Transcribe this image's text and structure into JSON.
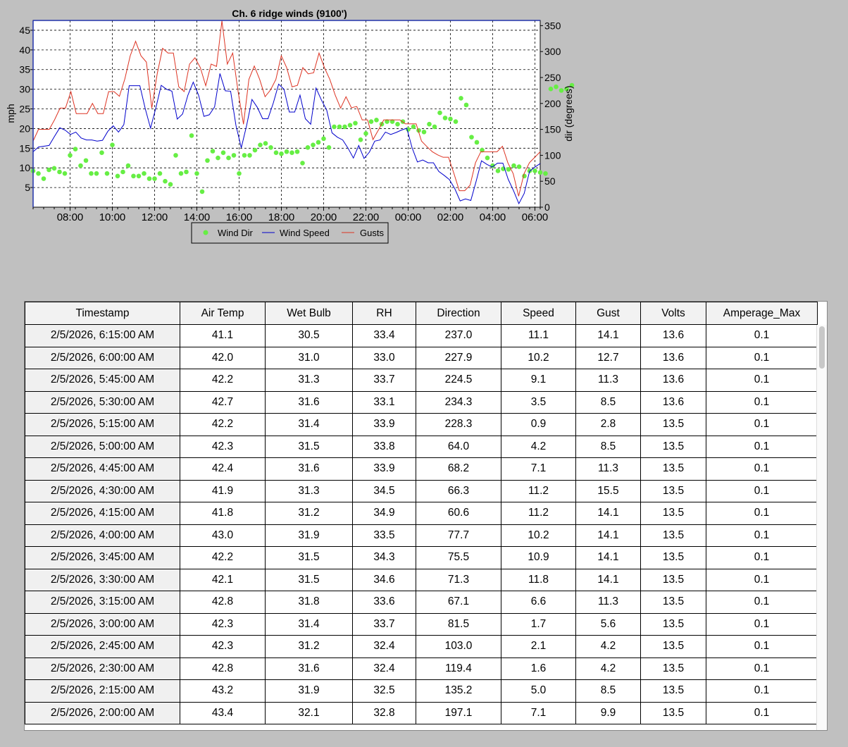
{
  "chart_data": {
    "type": "line",
    "title": "Ch. 6 ridge winds (9100')",
    "ylabel_left": "mph",
    "ylabel_right": "dir (degrees)",
    "ylim_left": [
      0,
      47.5
    ],
    "ylim_right": [
      0,
      360
    ],
    "yticks_left": [
      5,
      10,
      15,
      20,
      25,
      30,
      35,
      40,
      45
    ],
    "yticks_right": [
      0,
      50,
      100,
      150,
      200,
      250,
      300,
      350
    ],
    "xticks": [
      "08:00",
      "10:00",
      "12:00",
      "14:00",
      "16:00",
      "18:00",
      "20:00",
      "22:00",
      "00:00",
      "02:00",
      "04:00",
      "06:00"
    ],
    "x_start": "06:15",
    "x_end": "06:15",
    "interval_minutes": 15,
    "grid": true,
    "legend_position": "bottom",
    "series": [
      {
        "name": "Wind Dir",
        "color": "#66ee44",
        "style": "points",
        "values": [
          70,
          65,
          55,
          72,
          75,
          68,
          65,
          100,
          112,
          80,
          90,
          65,
          65,
          105,
          65,
          120,
          60,
          68,
          80,
          60,
          60,
          65,
          55,
          55,
          65,
          50,
          44,
          100,
          65,
          68,
          138,
          65,
          30,
          90,
          108,
          95,
          105,
          95,
          100,
          65,
          100,
          100,
          110,
          120,
          123,
          115,
          105,
          103,
          107,
          105,
          107,
          85,
          115,
          120,
          125,
          132,
          115,
          155,
          155,
          155,
          158,
          162,
          130,
          142,
          165,
          168,
          160,
          165,
          165,
          160,
          165,
          150,
          155,
          148,
          145,
          160,
          155,
          182,
          172,
          170,
          165,
          210,
          197,
          135,
          125,
          110,
          95,
          80,
          70,
          74,
          73,
          80,
          78,
          60,
          70,
          70,
          67,
          65,
          228,
          232,
          225,
          228,
          235
        ]
      },
      {
        "name": "Wind Speed",
        "color": "#0000cc",
        "style": "line",
        "values": [
          14.1,
          15.3,
          15.5,
          15.7,
          18,
          20.2,
          19.6,
          18.5,
          19.1,
          17.6,
          17.1,
          17.1,
          16.8,
          17,
          19.3,
          20.7,
          19.1,
          21,
          30.9,
          30.9,
          30.9,
          25.1,
          20.1,
          25.3,
          31,
          30,
          29.5,
          22.4,
          23.7,
          28.5,
          31.8,
          28.5,
          23.1,
          23.5,
          25.5,
          34,
          29.6,
          29.5,
          20.8,
          15.1,
          20.8,
          27.4,
          25.4,
          22.5,
          22.5,
          26.5,
          31.3,
          30,
          24.2,
          24.2,
          28.5,
          22.5,
          21.1,
          30.3,
          27.3,
          24.7,
          18.9,
          17.8,
          17.1,
          15,
          12.5,
          15.7,
          12.4,
          14,
          16.8,
          17.1,
          19.1,
          18.5,
          19,
          19.6,
          20.1,
          15.1,
          11.5,
          12,
          11.3,
          11.3,
          9.1,
          8.1,
          7,
          4.7,
          1.6,
          2.1,
          1.7,
          6.6,
          11.8,
          10.9,
          10.2,
          11.2,
          11.2,
          7.1,
          4.2,
          0.9,
          3.5,
          9.1,
          10.2,
          11.1
        ]
      },
      {
        "name": "Gusts",
        "color": "#dd3322",
        "style": "line",
        "values": [
          16.8,
          19.8,
          19.8,
          19.8,
          22.3,
          25.2,
          25.2,
          29.4,
          23.8,
          23.8,
          23.8,
          26.4,
          23.8,
          23.8,
          29.4,
          29.4,
          28.2,
          32.6,
          38.5,
          42.2,
          38.5,
          36.9,
          25.2,
          33.9,
          40.4,
          39.2,
          39.2,
          30.6,
          29.4,
          36.4,
          38,
          35.5,
          30.9,
          36.4,
          35.8,
          47.4,
          36.4,
          39.2,
          29.4,
          21.1,
          32.5,
          35.9,
          32.5,
          28.1,
          29.8,
          32.5,
          38.5,
          35.5,
          30.6,
          31,
          35.5,
          33.9,
          34.2,
          39.2,
          35.5,
          32.5,
          28.5,
          25.2,
          28.1,
          25.3,
          25.6,
          22.2,
          22.2,
          17.2,
          19.6,
          22.2,
          22.2,
          22.2,
          22.2,
          21.2,
          21.2,
          21.2,
          16.8,
          15.4,
          14.1,
          13.3,
          12.7,
          12.7,
          8.6,
          4.2,
          4.2,
          5.6,
          11.3,
          14.1,
          14.1,
          14.1,
          14.1,
          15.5,
          11.3,
          8.5,
          2.8,
          8.5,
          11.3,
          12.7,
          14.1
        ]
      }
    ]
  },
  "table": {
    "headers": [
      "Timestamp",
      "Air Temp",
      "Wet Bulb",
      "RH",
      "Direction",
      "Speed",
      "Gust",
      "Volts",
      "Amperage_Max"
    ],
    "rows": [
      [
        "2/5/2026, 6:15:00 AM",
        "41.1",
        "30.5",
        "33.4",
        "237.0",
        "11.1",
        "14.1",
        "13.6",
        "0.1"
      ],
      [
        "2/5/2026, 6:00:00 AM",
        "42.0",
        "31.0",
        "33.0",
        "227.9",
        "10.2",
        "12.7",
        "13.6",
        "0.1"
      ],
      [
        "2/5/2026, 5:45:00 AM",
        "42.2",
        "31.3",
        "33.7",
        "224.5",
        "9.1",
        "11.3",
        "13.6",
        "0.1"
      ],
      [
        "2/5/2026, 5:30:00 AM",
        "42.7",
        "31.6",
        "33.1",
        "234.3",
        "3.5",
        "8.5",
        "13.6",
        "0.1"
      ],
      [
        "2/5/2026, 5:15:00 AM",
        "42.2",
        "31.4",
        "33.9",
        "228.3",
        "0.9",
        "2.8",
        "13.5",
        "0.1"
      ],
      [
        "2/5/2026, 5:00:00 AM",
        "42.3",
        "31.5",
        "33.8",
        "64.0",
        "4.2",
        "8.5",
        "13.5",
        "0.1"
      ],
      [
        "2/5/2026, 4:45:00 AM",
        "42.4",
        "31.6",
        "33.9",
        "68.2",
        "7.1",
        "11.3",
        "13.5",
        "0.1"
      ],
      [
        "2/5/2026, 4:30:00 AM",
        "41.9",
        "31.3",
        "34.5",
        "66.3",
        "11.2",
        "15.5",
        "13.5",
        "0.1"
      ],
      [
        "2/5/2026, 4:15:00 AM",
        "41.8",
        "31.2",
        "34.9",
        "60.6",
        "11.2",
        "14.1",
        "13.5",
        "0.1"
      ],
      [
        "2/5/2026, 4:00:00 AM",
        "43.0",
        "31.9",
        "33.5",
        "77.7",
        "10.2",
        "14.1",
        "13.5",
        "0.1"
      ],
      [
        "2/5/2026, 3:45:00 AM",
        "42.2",
        "31.5",
        "34.3",
        "75.5",
        "10.9",
        "14.1",
        "13.5",
        "0.1"
      ],
      [
        "2/5/2026, 3:30:00 AM",
        "42.1",
        "31.5",
        "34.6",
        "71.3",
        "11.8",
        "14.1",
        "13.5",
        "0.1"
      ],
      [
        "2/5/2026, 3:15:00 AM",
        "42.8",
        "31.8",
        "33.6",
        "67.1",
        "6.6",
        "11.3",
        "13.5",
        "0.1"
      ],
      [
        "2/5/2026, 3:00:00 AM",
        "42.3",
        "31.4",
        "33.7",
        "81.5",
        "1.7",
        "5.6",
        "13.5",
        "0.1"
      ],
      [
        "2/5/2026, 2:45:00 AM",
        "42.3",
        "31.2",
        "32.4",
        "103.0",
        "2.1",
        "4.2",
        "13.5",
        "0.1"
      ],
      [
        "2/5/2026, 2:30:00 AM",
        "42.8",
        "31.6",
        "32.4",
        "119.4",
        "1.6",
        "4.2",
        "13.5",
        "0.1"
      ],
      [
        "2/5/2026, 2:15:00 AM",
        "43.2",
        "31.9",
        "32.5",
        "135.2",
        "5.0",
        "8.5",
        "13.5",
        "0.1"
      ],
      [
        "2/5/2026, 2:00:00 AM",
        "43.4",
        "32.1",
        "32.8",
        "197.1",
        "7.1",
        "9.9",
        "13.5",
        "0.1"
      ]
    ]
  }
}
